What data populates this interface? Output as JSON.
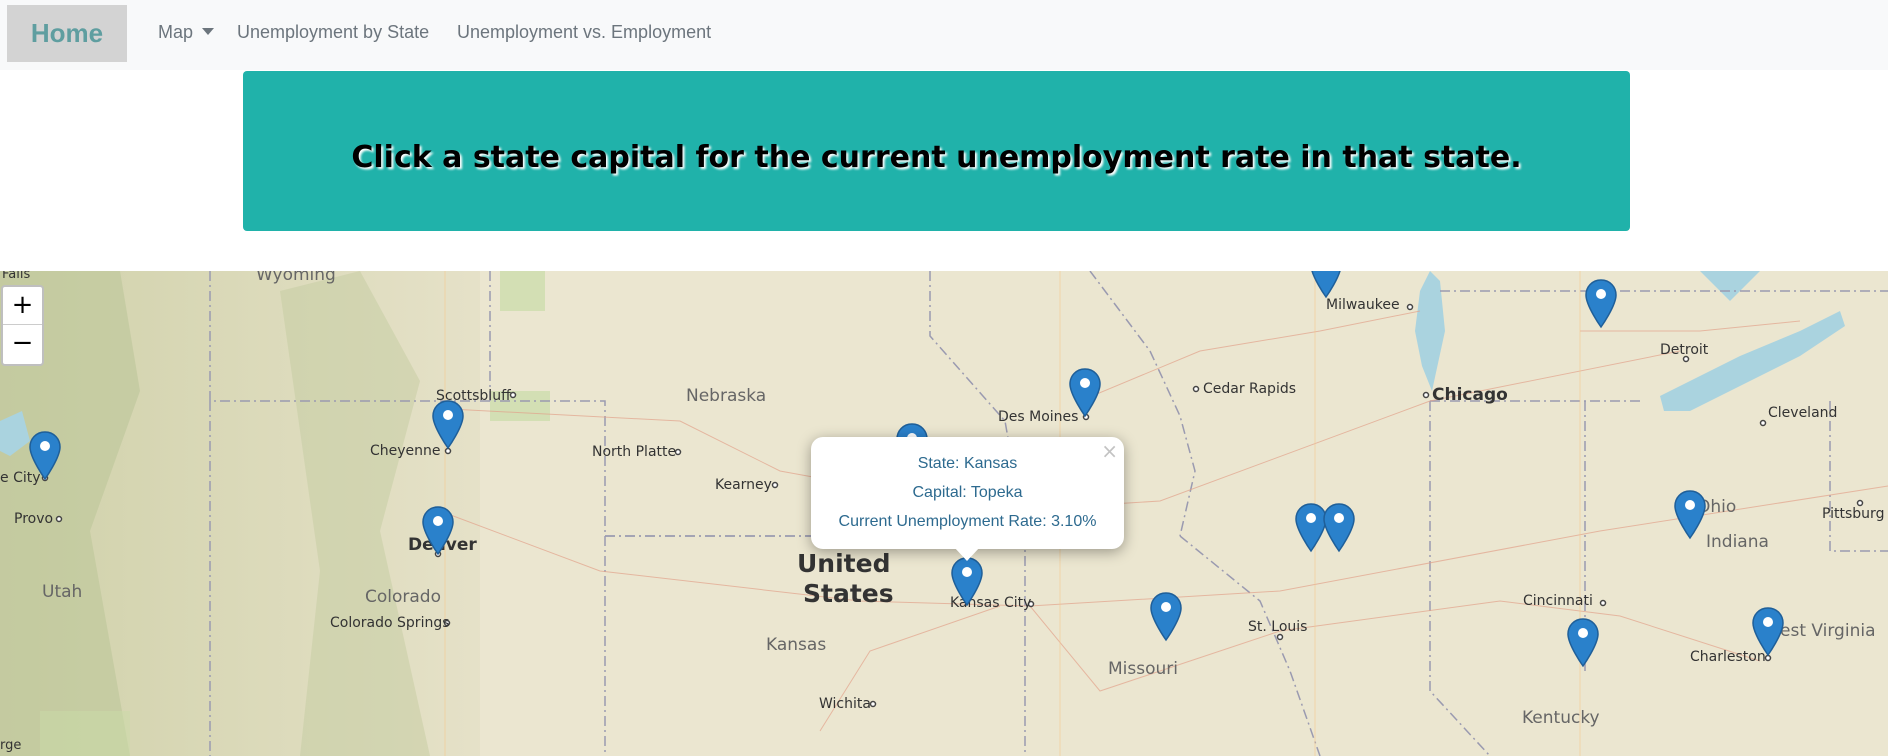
{
  "navbar": {
    "brand": "Home",
    "links": [
      "Map",
      "Unemployment by State",
      "Unemployment vs. Employment"
    ]
  },
  "banner": {
    "text": "Click a state capital for the current unemployment rate in that state."
  },
  "map": {
    "zoom_in": "+",
    "zoom_out": "−",
    "labels": {
      "falls": "Falls",
      "wyoming": "Wyoming",
      "milwaukee": "Milwaukee",
      "detroit": "Detroit",
      "scottsbluff": "Scottsbluff",
      "nebraska": "Nebraska",
      "cedar_rapids": "Cedar Rapids",
      "chicago": "Chicago",
      "cleveland": "Cleveland",
      "des_moines": "Des Moines",
      "cheyenne": "Cheyenne",
      "north_platte": "North Platte",
      "city_edge": "e City",
      "kearney": "Kearney",
      "provo": "Provo",
      "denver": "Denver",
      "pittsburgh": "Pittsburg",
      "indiana": "Indiana",
      "ohio": "Ohio",
      "utah": "Utah",
      "united": "United",
      "states": "States",
      "colorado": "Colorado",
      "kansas_city": "Kansas City",
      "cincinnati": "Cincinnati",
      "colorado_springs": "Colorado Springs",
      "st_louis": "St. Louis",
      "west_virginia": "est Virginia",
      "kansas": "Kansas",
      "missouri": "Missouri",
      "charleston": "Charleston",
      "wichita": "Wichita",
      "kentucky": "Kentucky",
      "rge": "rge"
    },
    "popup": {
      "close": "×",
      "state": "State: Kansas",
      "capital": "Capital: Topeka",
      "rate": "Current Unemployment Rate: 3.10%"
    },
    "colors": {
      "marker": "#2a81cb",
      "banner": "#20b2aa",
      "popup_text": "#2d6a8f"
    }
  }
}
